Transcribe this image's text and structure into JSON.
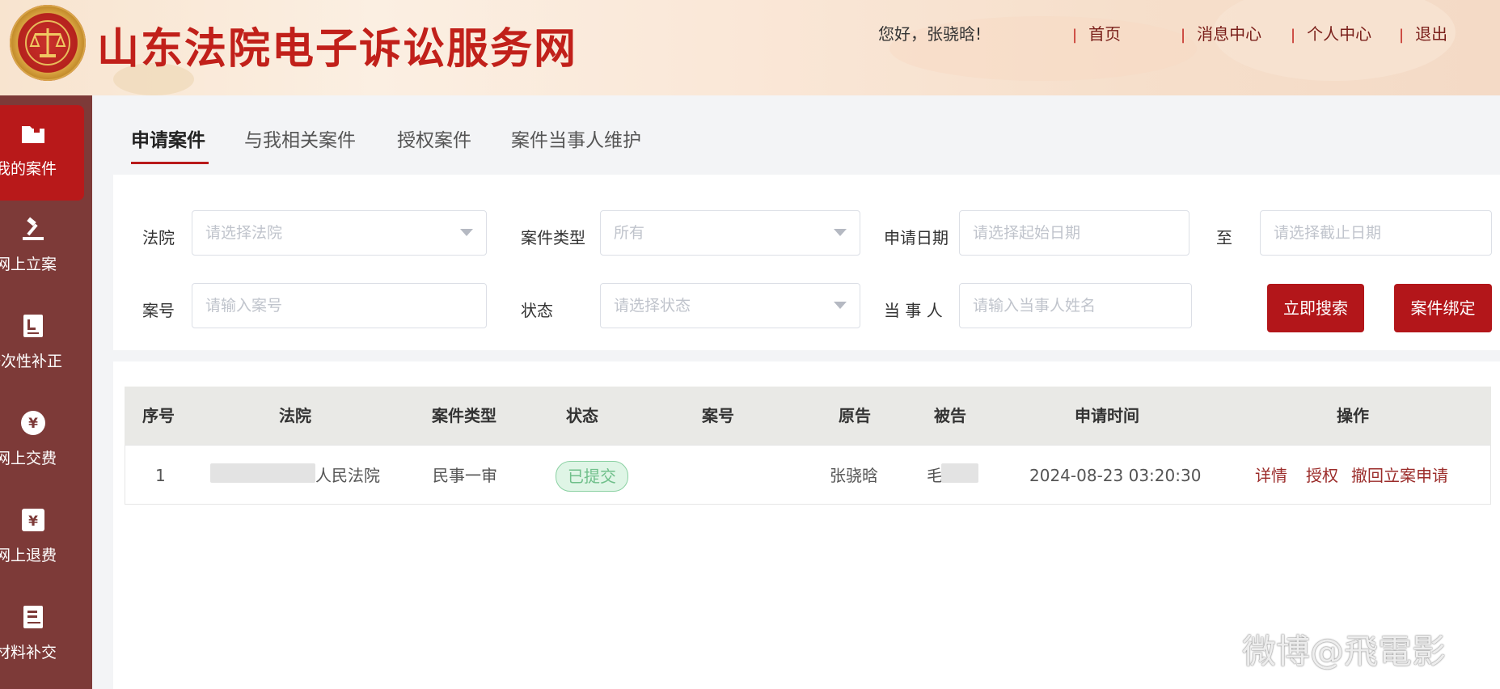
{
  "header": {
    "site_title": "山东法院电子诉讼服务网",
    "greeting": "您好，张骁晗!",
    "nav": [
      "首页",
      "消息中心",
      "个人中心",
      "退出"
    ]
  },
  "sidebar": {
    "items": [
      {
        "label": "我的案件",
        "icon": "folder-icon",
        "active": true
      },
      {
        "label": "网上立案",
        "icon": "gavel-icon"
      },
      {
        "label": "一次性补正",
        "icon": "document-edit-icon"
      },
      {
        "label": "网上交费",
        "icon": "yuan-circle-icon"
      },
      {
        "label": "网上退费",
        "icon": "yuan-square-icon"
      },
      {
        "label": "材料补交",
        "icon": "document-list-icon"
      }
    ]
  },
  "tabs": [
    {
      "label": "申请案件",
      "active": true
    },
    {
      "label": "与我相关案件"
    },
    {
      "label": "授权案件"
    },
    {
      "label": "案件当事人维护"
    }
  ],
  "filters": {
    "court_label": "法院",
    "court_placeholder": "请选择法院",
    "type_label": "案件类型",
    "type_value": "所有",
    "date_label": "申请日期",
    "date_start_placeholder": "请选择起始日期",
    "date_to": "至",
    "date_end_placeholder": "请选择截止日期",
    "caseno_label": "案号",
    "caseno_placeholder": "请输入案号",
    "status_label": "状态",
    "status_placeholder": "请选择状态",
    "party_label": "当 事 人",
    "party_placeholder": "请输入当事人姓名",
    "search_button": "立即搜索",
    "bind_button": "案件绑定"
  },
  "table": {
    "columns": [
      "序号",
      "法院",
      "案件类型",
      "状态",
      "案号",
      "原告",
      "被告",
      "申请时间",
      "操作"
    ],
    "rows": [
      {
        "index": "1",
        "court": "人民法院",
        "type": "民事一审",
        "status": "已提交",
        "case_no": "",
        "plaintiff": "张骁晗",
        "defendant": "毛",
        "time": "2024-08-23 03:20:30",
        "actions": [
          "详情",
          "授权",
          "撤回立案申请"
        ]
      }
    ]
  },
  "watermark": "微博@飛電影",
  "colors": {
    "brand_red": "#b3161a",
    "sidebar_bg": "#7d3a38",
    "status_green": "#6fbf8a"
  }
}
